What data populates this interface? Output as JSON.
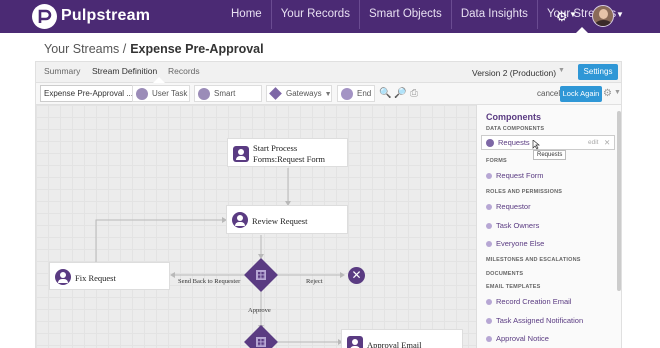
{
  "nav": {
    "brand": "Pulpstream",
    "links": [
      "Home",
      "Your Records",
      "Smart Objects",
      "Data Insights",
      "Your Streams"
    ],
    "active": "Your Streams",
    "icons": [
      "gear-icon",
      "chevron-down-icon",
      "avatar"
    ]
  },
  "breadcrumb": {
    "parent": "Your Streams /",
    "current": "Expense Pre-Approval"
  },
  "tabs": {
    "items": [
      "Summary",
      "Stream Definition",
      "Records"
    ],
    "active": "Stream Definition"
  },
  "version": {
    "label": "Version 2 (Production)"
  },
  "settings_label": "Settings",
  "toolbar": {
    "select_value": "Expense Pre-Approval ...",
    "user_task": "User Task",
    "smart_steps": "Smart Steps",
    "gateways": "Gateways",
    "end": "End",
    "cancel": "cancel",
    "lock": "Lock Again"
  },
  "diagram": {
    "start": {
      "line1": "Start Process",
      "line2": "Forms:Request Form"
    },
    "review": "Review Request",
    "fix": "Fix Request",
    "approval": "Approval Email",
    "edge_send_back": "Send Back to Requester",
    "edge_reject": "Reject",
    "edge_approve": "Approve"
  },
  "components": {
    "title": "Components",
    "sections": {
      "data": "DATA COMPONENTS",
      "forms": "FORMS",
      "roles": "ROLES AND PERMISSIONS",
      "milestones": "MILESTONES AND ESCALATIONS",
      "documents": "DOCUMENTS",
      "email": "EMAIL TEMPLATES"
    },
    "selected": {
      "label": "Requests",
      "edit": "edit",
      "tooltip": "Requests"
    },
    "forms_items": [
      "Request Form"
    ],
    "roles_items": [
      "Requestor",
      "Task Owners",
      "Everyone Else"
    ],
    "email_items": [
      "Record Creation Email",
      "Task Assigned Notification",
      "Approval Notice"
    ]
  },
  "colors": {
    "nav_bg": "#4b2a74",
    "accent": "#5a3b82",
    "button_blue": "#2f97d6"
  }
}
